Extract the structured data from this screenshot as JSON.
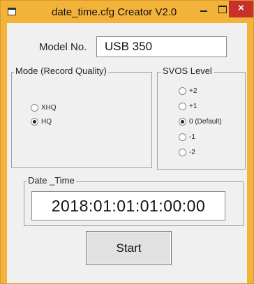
{
  "window": {
    "title": "date_time.cfg Creator V2.0",
    "close_glyph": "×"
  },
  "model": {
    "label": "Model No.",
    "value": "USB 350"
  },
  "mode_group": {
    "legend": "Mode (Record Quality)",
    "options": [
      {
        "label": "XHQ",
        "selected": false
      },
      {
        "label": "HQ",
        "selected": true
      }
    ]
  },
  "svos_group": {
    "legend": "SVOS Level",
    "options": [
      {
        "label": "+2",
        "selected": false
      },
      {
        "label": "+1",
        "selected": false
      },
      {
        "label": "0 (Default)",
        "selected": true
      },
      {
        "label": "-1",
        "selected": false
      },
      {
        "label": "-2",
        "selected": false
      }
    ]
  },
  "datetime_group": {
    "legend": "Date _Time",
    "value": "2018:01:01:01:00:00"
  },
  "start_button": {
    "label": "Start"
  }
}
